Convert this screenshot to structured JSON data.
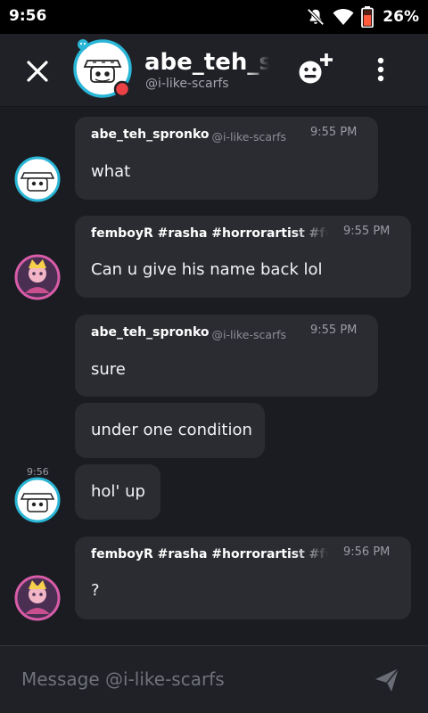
{
  "status_bar": {
    "time": "9:56",
    "battery": "26%",
    "icons": [
      "mute-icon",
      "wifi-icon",
      "battery-icon"
    ]
  },
  "header": {
    "name": "abe_teh_spr",
    "handle": "@i-like-scarfs",
    "icons": [
      "close-icon",
      "add-friend-icon",
      "more-icon"
    ]
  },
  "messages": [
    {
      "author": "abe_teh_spronko",
      "handle": "@i-like-scarfs",
      "time": "9:55 PM",
      "text": "what"
    },
    {
      "author": "femboyR #rasha #horrorartist #fu",
      "time": "9:55 PM",
      "text": "Can u give his name back lol"
    },
    {
      "author": "abe_teh_spronko",
      "handle": "@i-like-scarfs",
      "time": "9:55 PM",
      "text": "sure"
    },
    {
      "text": "under one condition"
    },
    {
      "side_time": "9:56",
      "text": "hol' up"
    },
    {
      "author": "femboyR #rasha #horrorartist #fu",
      "time": "9:56 PM",
      "text": "?"
    }
  ],
  "composer": {
    "placeholder": "Message @i-like-scarfs"
  },
  "colors": {
    "background": "#1b1c21",
    "header": "#202126",
    "bubble": "#2b2c32",
    "accent_teal": "#2ab6d6",
    "status_dnd": "#ed4245",
    "battery_low": "#ff5a3c"
  }
}
